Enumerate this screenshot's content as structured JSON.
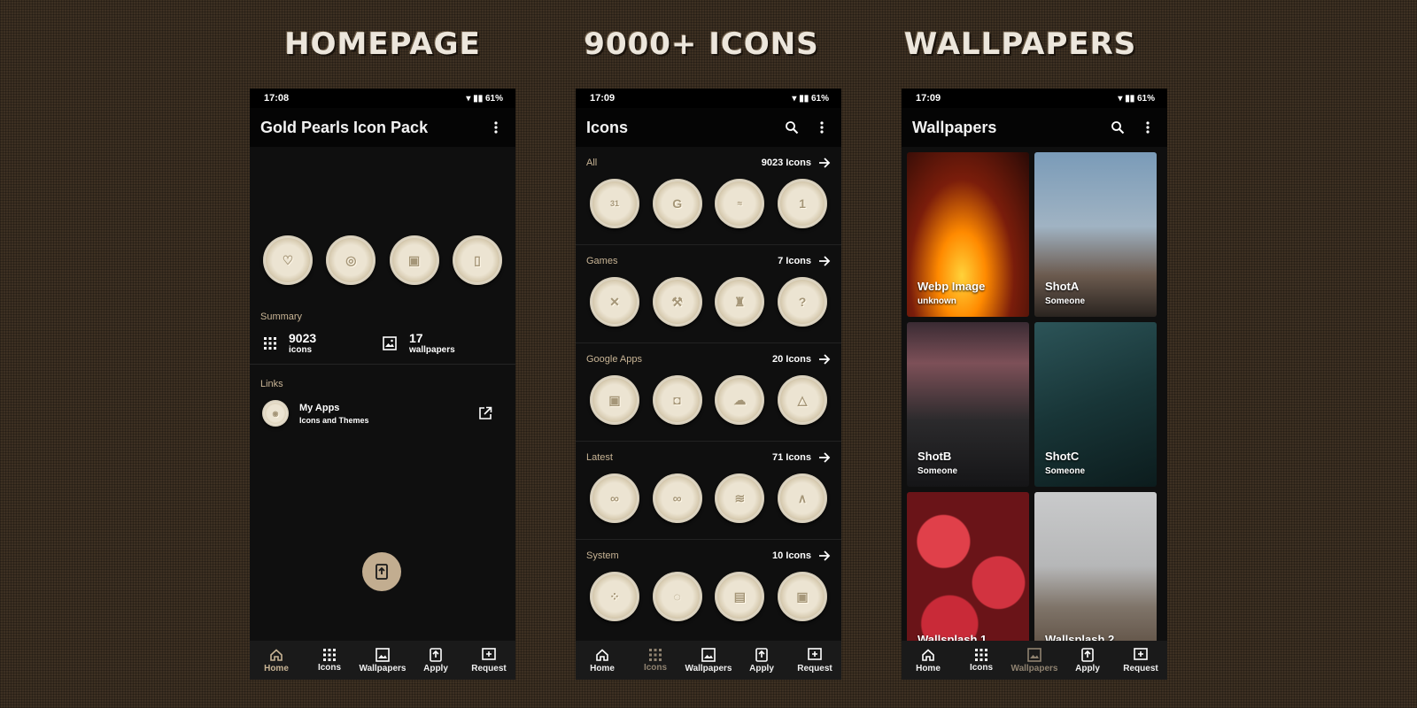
{
  "banners": {
    "homepage": "HOMEPAGE",
    "icons": "9000+ ICONS",
    "wallpapers": "WALLPAPERS"
  },
  "nav": {
    "home": "Home",
    "icons": "Icons",
    "wallpapers": "Wallpapers",
    "apply": "Apply",
    "request": "Request"
  },
  "home_screen": {
    "status_time": "17:08",
    "status_battery": "61%",
    "title": "Gold Pearls Icon Pack",
    "summary_label": "Summary",
    "icons_count": "9023",
    "icons_label": "icons",
    "wallpapers_count": "17",
    "wallpapers_label": "wallpapers",
    "links_label": "Links",
    "link_title": "My Apps",
    "link_sub": "Icons and Themes"
  },
  "icons_screen": {
    "status_time": "17:09",
    "status_battery": "61%",
    "title": "Icons",
    "categories": [
      {
        "name": "All",
        "count": "9023 Icons"
      },
      {
        "name": "Games",
        "count": "7 Icons"
      },
      {
        "name": "Google Apps",
        "count": "20 Icons"
      },
      {
        "name": "Latest",
        "count": "71 Icons"
      },
      {
        "name": "System",
        "count": "10 Icons"
      }
    ]
  },
  "wallpapers_screen": {
    "status_time": "17:09",
    "status_battery": "61%",
    "title": "Wallpapers",
    "items": [
      {
        "name": "Webp Image",
        "author": "unknown"
      },
      {
        "name": "ShotA",
        "author": "Someone"
      },
      {
        "name": "ShotB",
        "author": "Someone"
      },
      {
        "name": "ShotC",
        "author": "Someone"
      },
      {
        "name": "Wallsplash 1",
        "author": ""
      },
      {
        "name": "Wallsplash 2",
        "author": ""
      }
    ]
  },
  "colors": {
    "accent": "#c8b495",
    "fab": "#c2ad90",
    "phone_bg": "#0f0f0f"
  }
}
